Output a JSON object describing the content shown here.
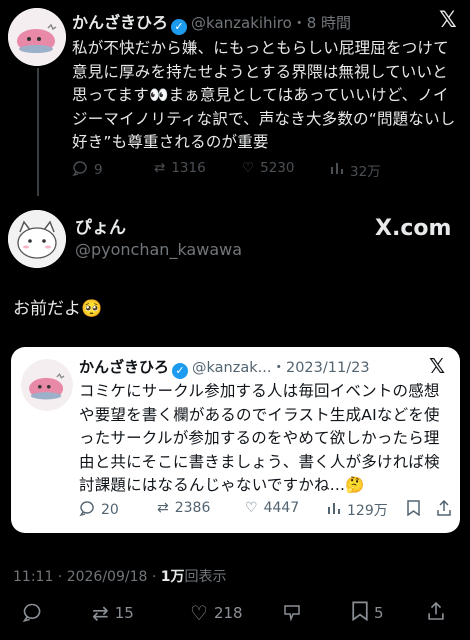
{
  "parent": {
    "name": "かんざきひろ",
    "handle": "@kanzakihiro",
    "time": "・8 時間",
    "text": "私が不快だから嫌、にもっともらしい屁理屈をつけて意見に厚みを持たせようとする界隈は無視していいと思ってます👀まぁ意見としてはあっていいけど、ノイジーマイノリティな訳で、声なき大多数の“問題ないし好き”も尊重されるのが重要",
    "stats": {
      "replies": "9",
      "reposts": "1316",
      "likes": "5230",
      "views": "32万"
    }
  },
  "reply": {
    "name": "ぴょん",
    "handle": "@pyonchan_kawawa",
    "text": "お前だよ🥺",
    "brand": "X.com"
  },
  "quote": {
    "name": "かんざきひろ",
    "handle": "@kanzak...",
    "date": "・2023/11/23",
    "text": "コミケにサークル参加する人は毎回イベントの感想や要望を書く欄があるのでイラスト生成AIなどを使ったサークルが参加するのをやめて欲しかったら理由と共にそこに書きましょう、書く人が多ければ検討課題にはなるんじゃないですかね...🤔",
    "stats": {
      "replies": "20",
      "reposts": "2386",
      "likes": "4447",
      "views": "129万"
    }
  },
  "meta": {
    "datetime": "11:11 · 2026/09/18 · ",
    "views": "1万",
    "views_label": "回表示"
  },
  "bottom": {
    "reposts": "15",
    "likes": "218",
    "bookmarks": "5"
  },
  "colors": {
    "background": "#000000",
    "verified": "#1d9bf0",
    "card": "#ffffff"
  }
}
